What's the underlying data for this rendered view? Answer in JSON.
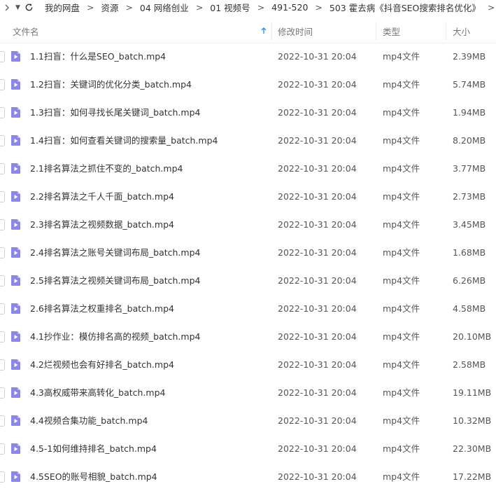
{
  "breadcrumbs": [
    "我的网盘",
    "资源",
    "04 网络创业",
    "01 视频号",
    "491-520",
    "503 霍去病《抖音SEO搜索排名优化》"
  ],
  "breadcrumb_separator": ">",
  "columns": {
    "name": "文件名",
    "modified": "修改时间",
    "type": "类型",
    "size": "大小"
  },
  "accent_color": "#3a8ef0",
  "file_icon_color": "#8b86e8",
  "files": [
    {
      "name": "1.1扫盲：什么是SEO_batch.mp4",
      "modified": "2022-10-31 20:04",
      "type": "mp4文件",
      "size": "2.39MB"
    },
    {
      "name": "1.2扫盲：关键词的优化分类_batch.mp4",
      "modified": "2022-10-31 20:04",
      "type": "mp4文件",
      "size": "5.74MB"
    },
    {
      "name": "1.3扫盲：如何寻找长尾关键词_batch.mp4",
      "modified": "2022-10-31 20:04",
      "type": "mp4文件",
      "size": "1.94MB"
    },
    {
      "name": "1.4扫盲：如何查看关键词的搜索量_batch.mp4",
      "modified": "2022-10-31 20:04",
      "type": "mp4文件",
      "size": "8.20MB"
    },
    {
      "name": "2.1排名算法之抓住不变的_batch.mp4",
      "modified": "2022-10-31 20:04",
      "type": "mp4文件",
      "size": "3.77MB"
    },
    {
      "name": "2.2排名算法之千人千面_batch.mp4",
      "modified": "2022-10-31 20:04",
      "type": "mp4文件",
      "size": "2.73MB"
    },
    {
      "name": "2.3排名算法之视频数据_batch.mp4",
      "modified": "2022-10-31 20:04",
      "type": "mp4文件",
      "size": "3.45MB"
    },
    {
      "name": "2.4排名算法之账号关键词布局_batch.mp4",
      "modified": "2022-10-31 20:04",
      "type": "mp4文件",
      "size": "1.68MB"
    },
    {
      "name": "2.5排名算法之视频关键词布局_batch.mp4",
      "modified": "2022-10-31 20:04",
      "type": "mp4文件",
      "size": "6.26MB"
    },
    {
      "name": "2.6排名算法之权重排名_batch.mp4",
      "modified": "2022-10-31 20:04",
      "type": "mp4文件",
      "size": "4.58MB"
    },
    {
      "name": "4.1抄作业：模仿排名高的视频_batch.mp4",
      "modified": "2022-10-31 20:04",
      "type": "mp4文件",
      "size": "20.10MB"
    },
    {
      "name": "4.2烂视频也会有好排名_batch.mp4",
      "modified": "2022-10-31 20:04",
      "type": "mp4文件",
      "size": "2.58MB"
    },
    {
      "name": "4.3高权威带来高转化_batch.mp4",
      "modified": "2022-10-31 20:04",
      "type": "mp4文件",
      "size": "19.11MB"
    },
    {
      "name": "4.4视频合集功能_batch.mp4",
      "modified": "2022-10-31 20:04",
      "type": "mp4文件",
      "size": "10.32MB"
    },
    {
      "name": "4.5-1如何维持排名_batch.mp4",
      "modified": "2022-10-31 20:04",
      "type": "mp4文件",
      "size": "22.30MB"
    },
    {
      "name": "4.5SEO的账号相貌_batch.mp4",
      "modified": "2022-10-31 20:04",
      "type": "mp4文件",
      "size": "17.22MB"
    }
  ]
}
